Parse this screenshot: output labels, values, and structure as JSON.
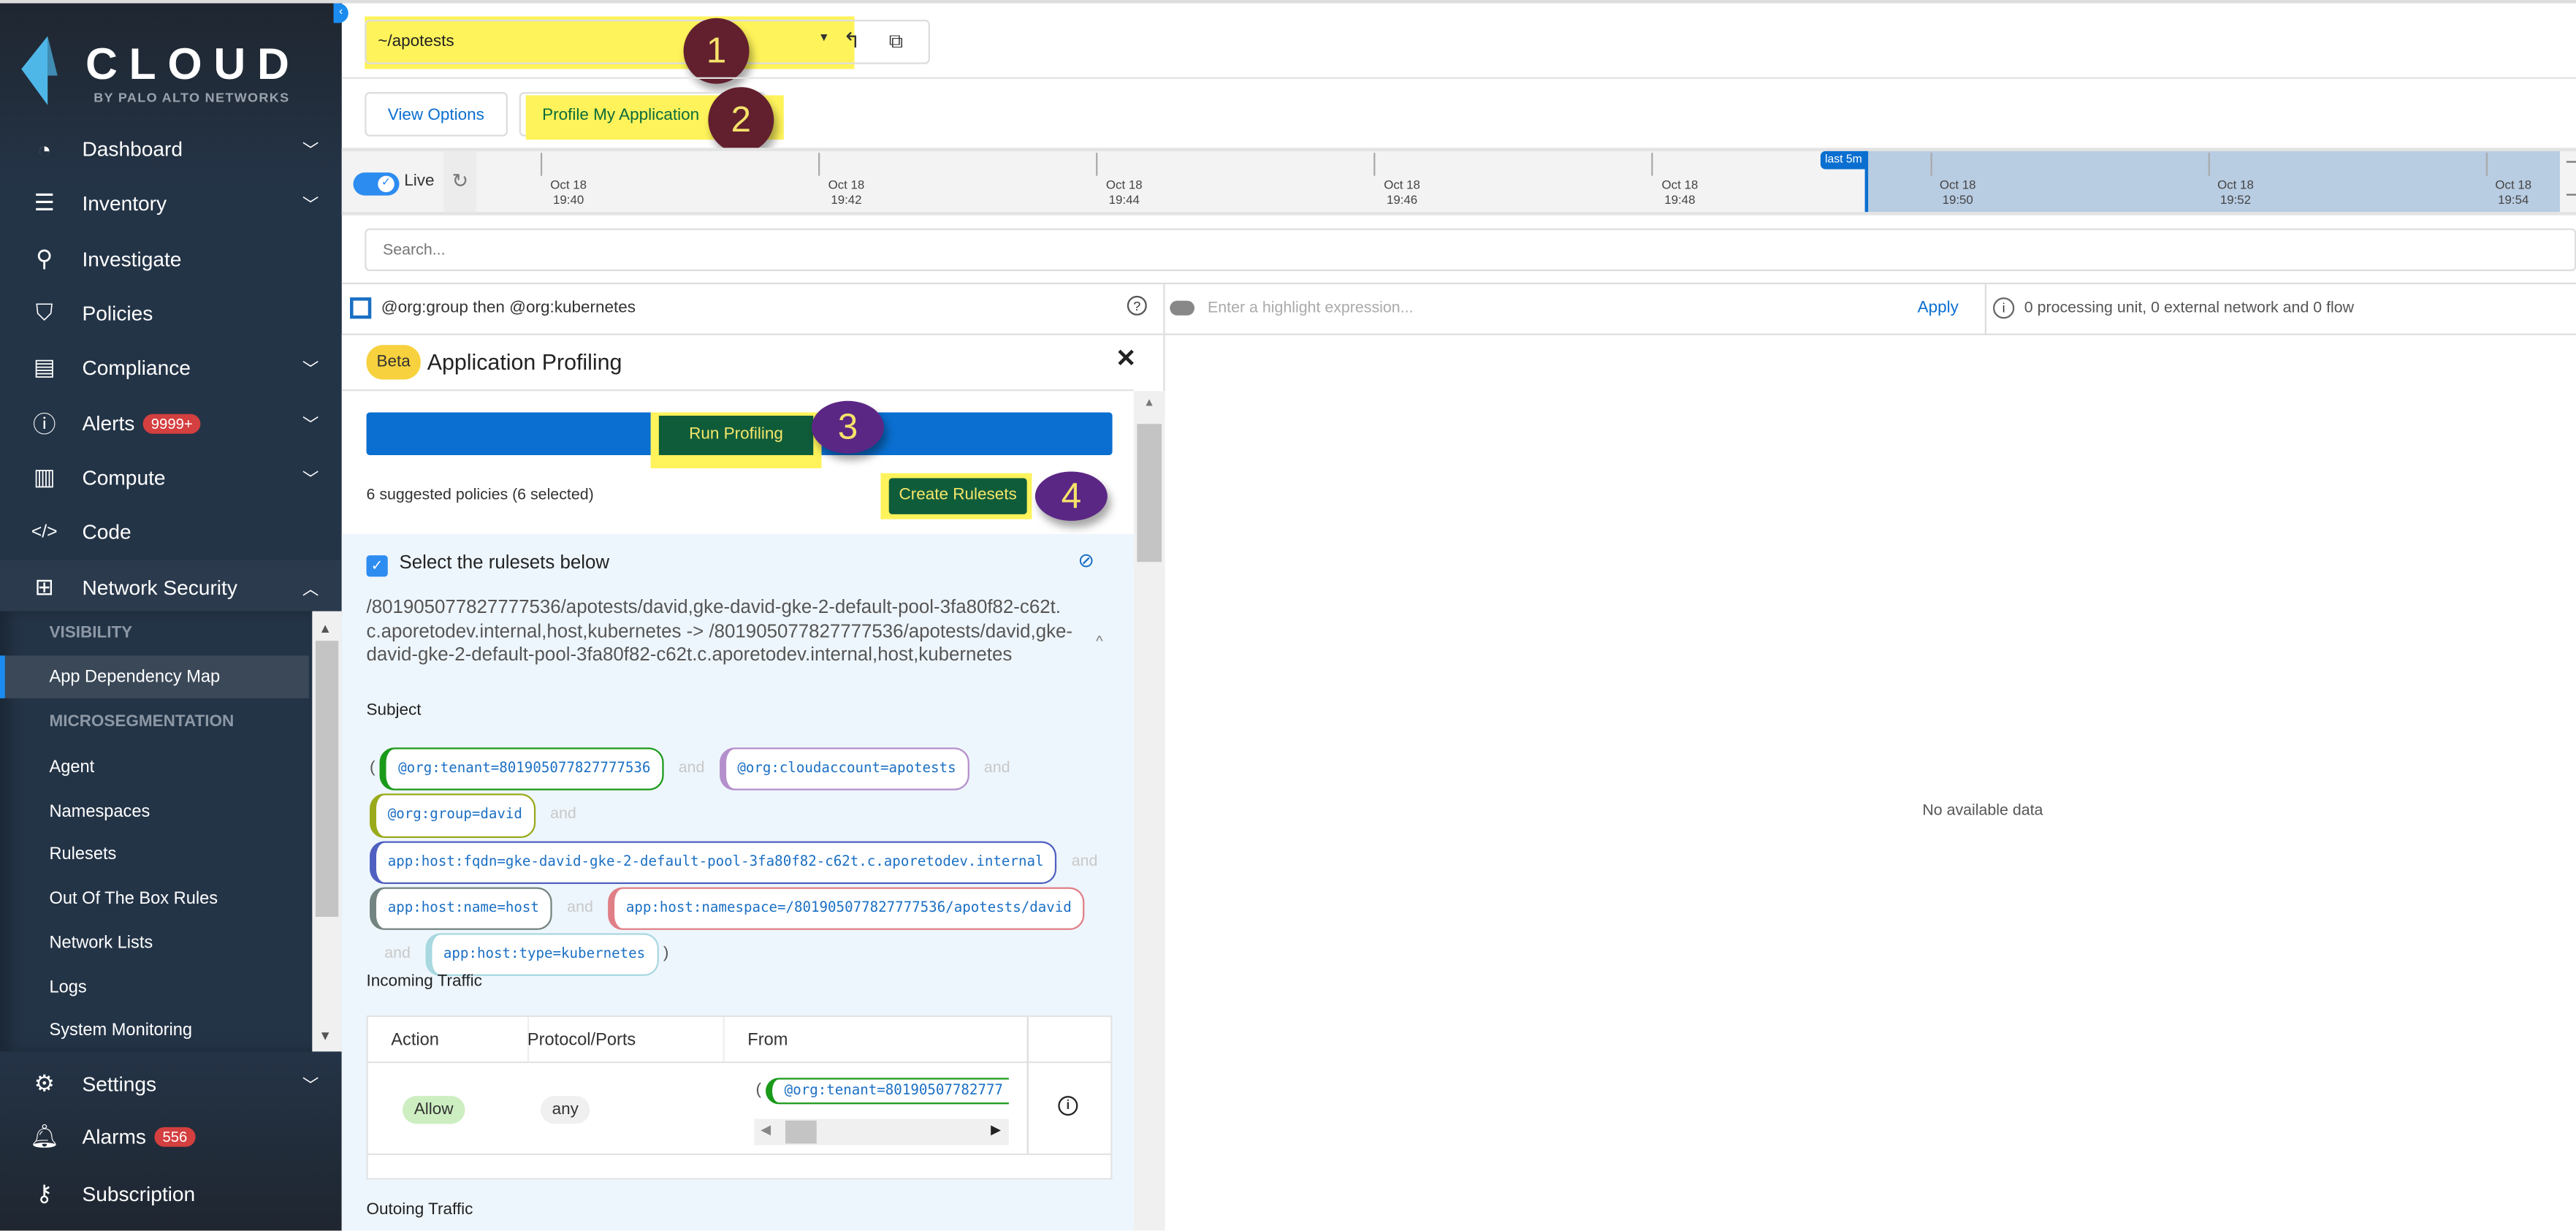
{
  "brand": {
    "name": "CLOUD",
    "tagline": "BY PALO ALTO NETWORKS"
  },
  "sidebar": {
    "items": [
      {
        "label": "Dashboard",
        "icon": "gauge-icon",
        "chevron": true
      },
      {
        "label": "Inventory",
        "icon": "list-check-icon",
        "chevron": true
      },
      {
        "label": "Investigate",
        "icon": "search-icon",
        "chevron": false
      },
      {
        "label": "Policies",
        "icon": "shield-check-icon",
        "chevron": false
      },
      {
        "label": "Compliance",
        "icon": "compliance-doc-icon",
        "chevron": true
      },
      {
        "label": "Alerts",
        "icon": "alert-circle-icon",
        "chevron": true,
        "badge": "9999+"
      },
      {
        "label": "Compute",
        "icon": "compute-icon",
        "chevron": true
      },
      {
        "label": "Code",
        "icon": "code-icon",
        "chevron": false
      },
      {
        "label": "Network Security",
        "icon": "network-icon",
        "chevron": true,
        "open": true
      }
    ],
    "submenu": {
      "visibility_header": "VISIBILITY",
      "visibility_items": [
        "App Dependency Map"
      ],
      "micro_header": "MICROSEGMENTATION",
      "micro_items": [
        "Agent",
        "Namespaces",
        "Rulesets",
        "Out Of The Box Rules",
        "Network Lists",
        "Logs",
        "System Monitoring"
      ]
    },
    "bottom": [
      {
        "label": "Settings",
        "icon": "gear-wrench-icon"
      },
      {
        "label": "Alarms",
        "icon": "bell-icon",
        "badge": "556"
      },
      {
        "label": "Subscription",
        "icon": "keys-icon"
      }
    ]
  },
  "namespace": {
    "value": "~/apotests"
  },
  "toolbar": {
    "view_options": "View Options",
    "profile": "Profile My Application"
  },
  "steps": [
    "1",
    "2",
    "3",
    "4"
  ],
  "timeline": {
    "live": "Live",
    "ticks": [
      {
        "d": "Oct 18",
        "t": "19:40"
      },
      {
        "d": "Oct 18",
        "t": "19:42"
      },
      {
        "d": "Oct 18",
        "t": "19:44"
      },
      {
        "d": "Oct 18",
        "t": "19:46"
      },
      {
        "d": "Oct 18",
        "t": "19:48"
      },
      {
        "d": "Oct 18",
        "t": "19:50"
      },
      {
        "d": "Oct 18",
        "t": "19:52"
      },
      {
        "d": "Oct 18",
        "t": "19:54"
      }
    ],
    "range": "last 5m"
  },
  "search": {
    "placeholder": "Search..."
  },
  "filter": {
    "grouping": "@org:group then @org:kubernetes",
    "highlight_placeholder": "Enter a highlight expression...",
    "apply": "Apply",
    "summary": "0 processing unit, 0 external network and 0 flow"
  },
  "panel": {
    "beta": "Beta",
    "title": "Application Profiling",
    "run": "Run Profiling",
    "suggested": "6 suggested policies (6 selected)",
    "create": "Create Rulesets",
    "select_label": "Select the rulesets below",
    "ruleset_name": "/801905077827777536/apotests/david,gke-david-gke-2-default-pool-3fa80f82-c62t.c.aporetodev.internal,host,kubernetes -> /801905077827777536/apotests/david,gke-david-gke-2-default-pool-3fa80f82-c62t.c.aporetodev.internal,host,kubernetes",
    "subject_label": "Subject",
    "and": "and",
    "open_paren": "(",
    "close_paren": ")",
    "tags": [
      {
        "text": "@org:tenant=801905077827777536",
        "color": "#1a9a1a"
      },
      {
        "text": "@org:cloudaccount=apotests",
        "color": "#b58fcc"
      },
      {
        "text": "@org:group=david",
        "color": "#9aaa1a"
      },
      {
        "text": "app:host:fqdn=gke-david-gke-2-default-pool-3fa80f82-c62t.c.aporetodev.internal",
        "color": "#5060c0"
      },
      {
        "text": "app:host:name=host",
        "color": "#748480"
      },
      {
        "text": "app:host:namespace=/801905077827777536/apotests/david",
        "color": "#e07f86"
      },
      {
        "text": "app:host:type=kubernetes",
        "color": "#a8d8e0"
      }
    ],
    "incoming_label": "Incoming Traffic",
    "columns": [
      "Action",
      "Protocol/Ports",
      "From"
    ],
    "row": {
      "action": "Allow",
      "ports": "any",
      "from": "@org:tenant=80190507782777"
    },
    "outgoing_label": "Outoing Traffic"
  },
  "map": {
    "empty": "No available data"
  }
}
